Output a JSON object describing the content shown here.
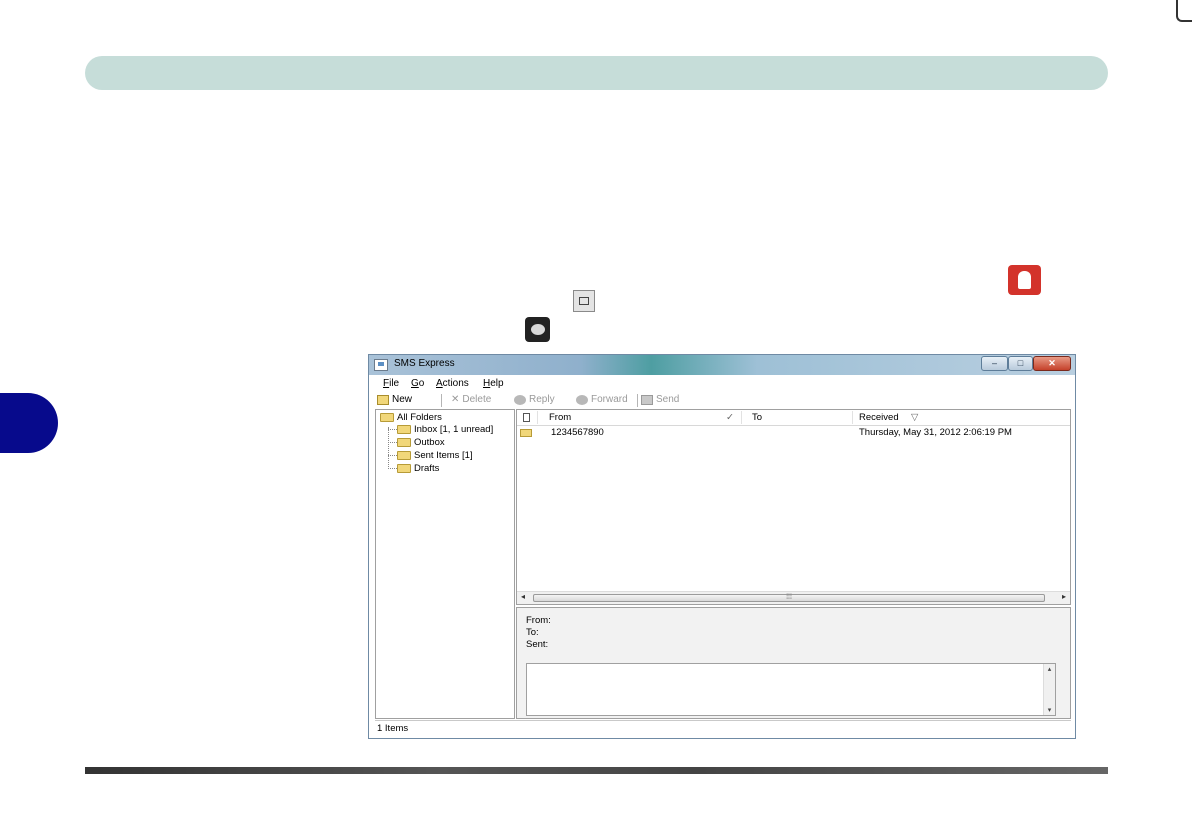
{
  "window": {
    "title": "SMS Express",
    "controls": {
      "minimize": "–",
      "maximize": "□",
      "close": "✕"
    }
  },
  "menu": {
    "file": "File",
    "go": "Go",
    "actions": "Actions",
    "help": "Help"
  },
  "toolbar": {
    "new": "New",
    "delete": "Delete",
    "reply": "Reply",
    "forward": "Forward",
    "send": "Send"
  },
  "folders": {
    "root": "All Folders",
    "items": [
      "Inbox [1, 1 unread]",
      "Outbox",
      "Sent Items [1]",
      "Drafts"
    ]
  },
  "message_list": {
    "columns": {
      "from": "From",
      "check": "✓",
      "to": "To",
      "received": "Received",
      "sort": "▽"
    },
    "rows": [
      {
        "from": "1234567890",
        "to": "",
        "received": "Thursday, May 31, 2012 2:06:19 PM"
      }
    ]
  },
  "preview": {
    "from": "From:",
    "to": "To:",
    "sent": "Sent:"
  },
  "status": "1 Items",
  "icons": [
    "phone-app-icon",
    "menu-key-icon",
    "message-bubble-icon",
    "folder-icon",
    "mail-icon"
  ],
  "colors": {
    "header_bar": "#c6ddd9",
    "side_tab": "#070a8c",
    "phone_icon": "#d3332b"
  }
}
